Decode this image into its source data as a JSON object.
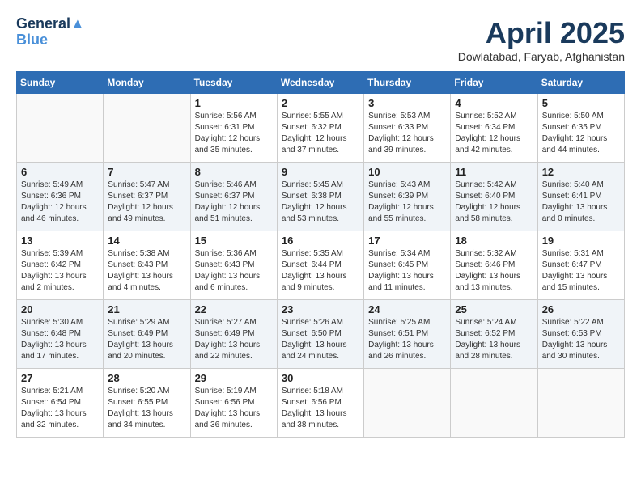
{
  "header": {
    "logo_line1": "General",
    "logo_line2": "Blue",
    "month": "April 2025",
    "location": "Dowlatabad, Faryab, Afghanistan"
  },
  "weekdays": [
    "Sunday",
    "Monday",
    "Tuesday",
    "Wednesday",
    "Thursday",
    "Friday",
    "Saturday"
  ],
  "weeks": [
    [
      {
        "day": "",
        "sunrise": "",
        "sunset": "",
        "daylight": ""
      },
      {
        "day": "",
        "sunrise": "",
        "sunset": "",
        "daylight": ""
      },
      {
        "day": "1",
        "sunrise": "Sunrise: 5:56 AM",
        "sunset": "Sunset: 6:31 PM",
        "daylight": "Daylight: 12 hours and 35 minutes."
      },
      {
        "day": "2",
        "sunrise": "Sunrise: 5:55 AM",
        "sunset": "Sunset: 6:32 PM",
        "daylight": "Daylight: 12 hours and 37 minutes."
      },
      {
        "day": "3",
        "sunrise": "Sunrise: 5:53 AM",
        "sunset": "Sunset: 6:33 PM",
        "daylight": "Daylight: 12 hours and 39 minutes."
      },
      {
        "day": "4",
        "sunrise": "Sunrise: 5:52 AM",
        "sunset": "Sunset: 6:34 PM",
        "daylight": "Daylight: 12 hours and 42 minutes."
      },
      {
        "day": "5",
        "sunrise": "Sunrise: 5:50 AM",
        "sunset": "Sunset: 6:35 PM",
        "daylight": "Daylight: 12 hours and 44 minutes."
      }
    ],
    [
      {
        "day": "6",
        "sunrise": "Sunrise: 5:49 AM",
        "sunset": "Sunset: 6:36 PM",
        "daylight": "Daylight: 12 hours and 46 minutes."
      },
      {
        "day": "7",
        "sunrise": "Sunrise: 5:47 AM",
        "sunset": "Sunset: 6:37 PM",
        "daylight": "Daylight: 12 hours and 49 minutes."
      },
      {
        "day": "8",
        "sunrise": "Sunrise: 5:46 AM",
        "sunset": "Sunset: 6:37 PM",
        "daylight": "Daylight: 12 hours and 51 minutes."
      },
      {
        "day": "9",
        "sunrise": "Sunrise: 5:45 AM",
        "sunset": "Sunset: 6:38 PM",
        "daylight": "Daylight: 12 hours and 53 minutes."
      },
      {
        "day": "10",
        "sunrise": "Sunrise: 5:43 AM",
        "sunset": "Sunset: 6:39 PM",
        "daylight": "Daylight: 12 hours and 55 minutes."
      },
      {
        "day": "11",
        "sunrise": "Sunrise: 5:42 AM",
        "sunset": "Sunset: 6:40 PM",
        "daylight": "Daylight: 12 hours and 58 minutes."
      },
      {
        "day": "12",
        "sunrise": "Sunrise: 5:40 AM",
        "sunset": "Sunset: 6:41 PM",
        "daylight": "Daylight: 13 hours and 0 minutes."
      }
    ],
    [
      {
        "day": "13",
        "sunrise": "Sunrise: 5:39 AM",
        "sunset": "Sunset: 6:42 PM",
        "daylight": "Daylight: 13 hours and 2 minutes."
      },
      {
        "day": "14",
        "sunrise": "Sunrise: 5:38 AM",
        "sunset": "Sunset: 6:43 PM",
        "daylight": "Daylight: 13 hours and 4 minutes."
      },
      {
        "day": "15",
        "sunrise": "Sunrise: 5:36 AM",
        "sunset": "Sunset: 6:43 PM",
        "daylight": "Daylight: 13 hours and 6 minutes."
      },
      {
        "day": "16",
        "sunrise": "Sunrise: 5:35 AM",
        "sunset": "Sunset: 6:44 PM",
        "daylight": "Daylight: 13 hours and 9 minutes."
      },
      {
        "day": "17",
        "sunrise": "Sunrise: 5:34 AM",
        "sunset": "Sunset: 6:45 PM",
        "daylight": "Daylight: 13 hours and 11 minutes."
      },
      {
        "day": "18",
        "sunrise": "Sunrise: 5:32 AM",
        "sunset": "Sunset: 6:46 PM",
        "daylight": "Daylight: 13 hours and 13 minutes."
      },
      {
        "day": "19",
        "sunrise": "Sunrise: 5:31 AM",
        "sunset": "Sunset: 6:47 PM",
        "daylight": "Daylight: 13 hours and 15 minutes."
      }
    ],
    [
      {
        "day": "20",
        "sunrise": "Sunrise: 5:30 AM",
        "sunset": "Sunset: 6:48 PM",
        "daylight": "Daylight: 13 hours and 17 minutes."
      },
      {
        "day": "21",
        "sunrise": "Sunrise: 5:29 AM",
        "sunset": "Sunset: 6:49 PM",
        "daylight": "Daylight: 13 hours and 20 minutes."
      },
      {
        "day": "22",
        "sunrise": "Sunrise: 5:27 AM",
        "sunset": "Sunset: 6:49 PM",
        "daylight": "Daylight: 13 hours and 22 minutes."
      },
      {
        "day": "23",
        "sunrise": "Sunrise: 5:26 AM",
        "sunset": "Sunset: 6:50 PM",
        "daylight": "Daylight: 13 hours and 24 minutes."
      },
      {
        "day": "24",
        "sunrise": "Sunrise: 5:25 AM",
        "sunset": "Sunset: 6:51 PM",
        "daylight": "Daylight: 13 hours and 26 minutes."
      },
      {
        "day": "25",
        "sunrise": "Sunrise: 5:24 AM",
        "sunset": "Sunset: 6:52 PM",
        "daylight": "Daylight: 13 hours and 28 minutes."
      },
      {
        "day": "26",
        "sunrise": "Sunrise: 5:22 AM",
        "sunset": "Sunset: 6:53 PM",
        "daylight": "Daylight: 13 hours and 30 minutes."
      }
    ],
    [
      {
        "day": "27",
        "sunrise": "Sunrise: 5:21 AM",
        "sunset": "Sunset: 6:54 PM",
        "daylight": "Daylight: 13 hours and 32 minutes."
      },
      {
        "day": "28",
        "sunrise": "Sunrise: 5:20 AM",
        "sunset": "Sunset: 6:55 PM",
        "daylight": "Daylight: 13 hours and 34 minutes."
      },
      {
        "day": "29",
        "sunrise": "Sunrise: 5:19 AM",
        "sunset": "Sunset: 6:56 PM",
        "daylight": "Daylight: 13 hours and 36 minutes."
      },
      {
        "day": "30",
        "sunrise": "Sunrise: 5:18 AM",
        "sunset": "Sunset: 6:56 PM",
        "daylight": "Daylight: 13 hours and 38 minutes."
      },
      {
        "day": "",
        "sunrise": "",
        "sunset": "",
        "daylight": ""
      },
      {
        "day": "",
        "sunrise": "",
        "sunset": "",
        "daylight": ""
      },
      {
        "day": "",
        "sunrise": "",
        "sunset": "",
        "daylight": ""
      }
    ]
  ]
}
